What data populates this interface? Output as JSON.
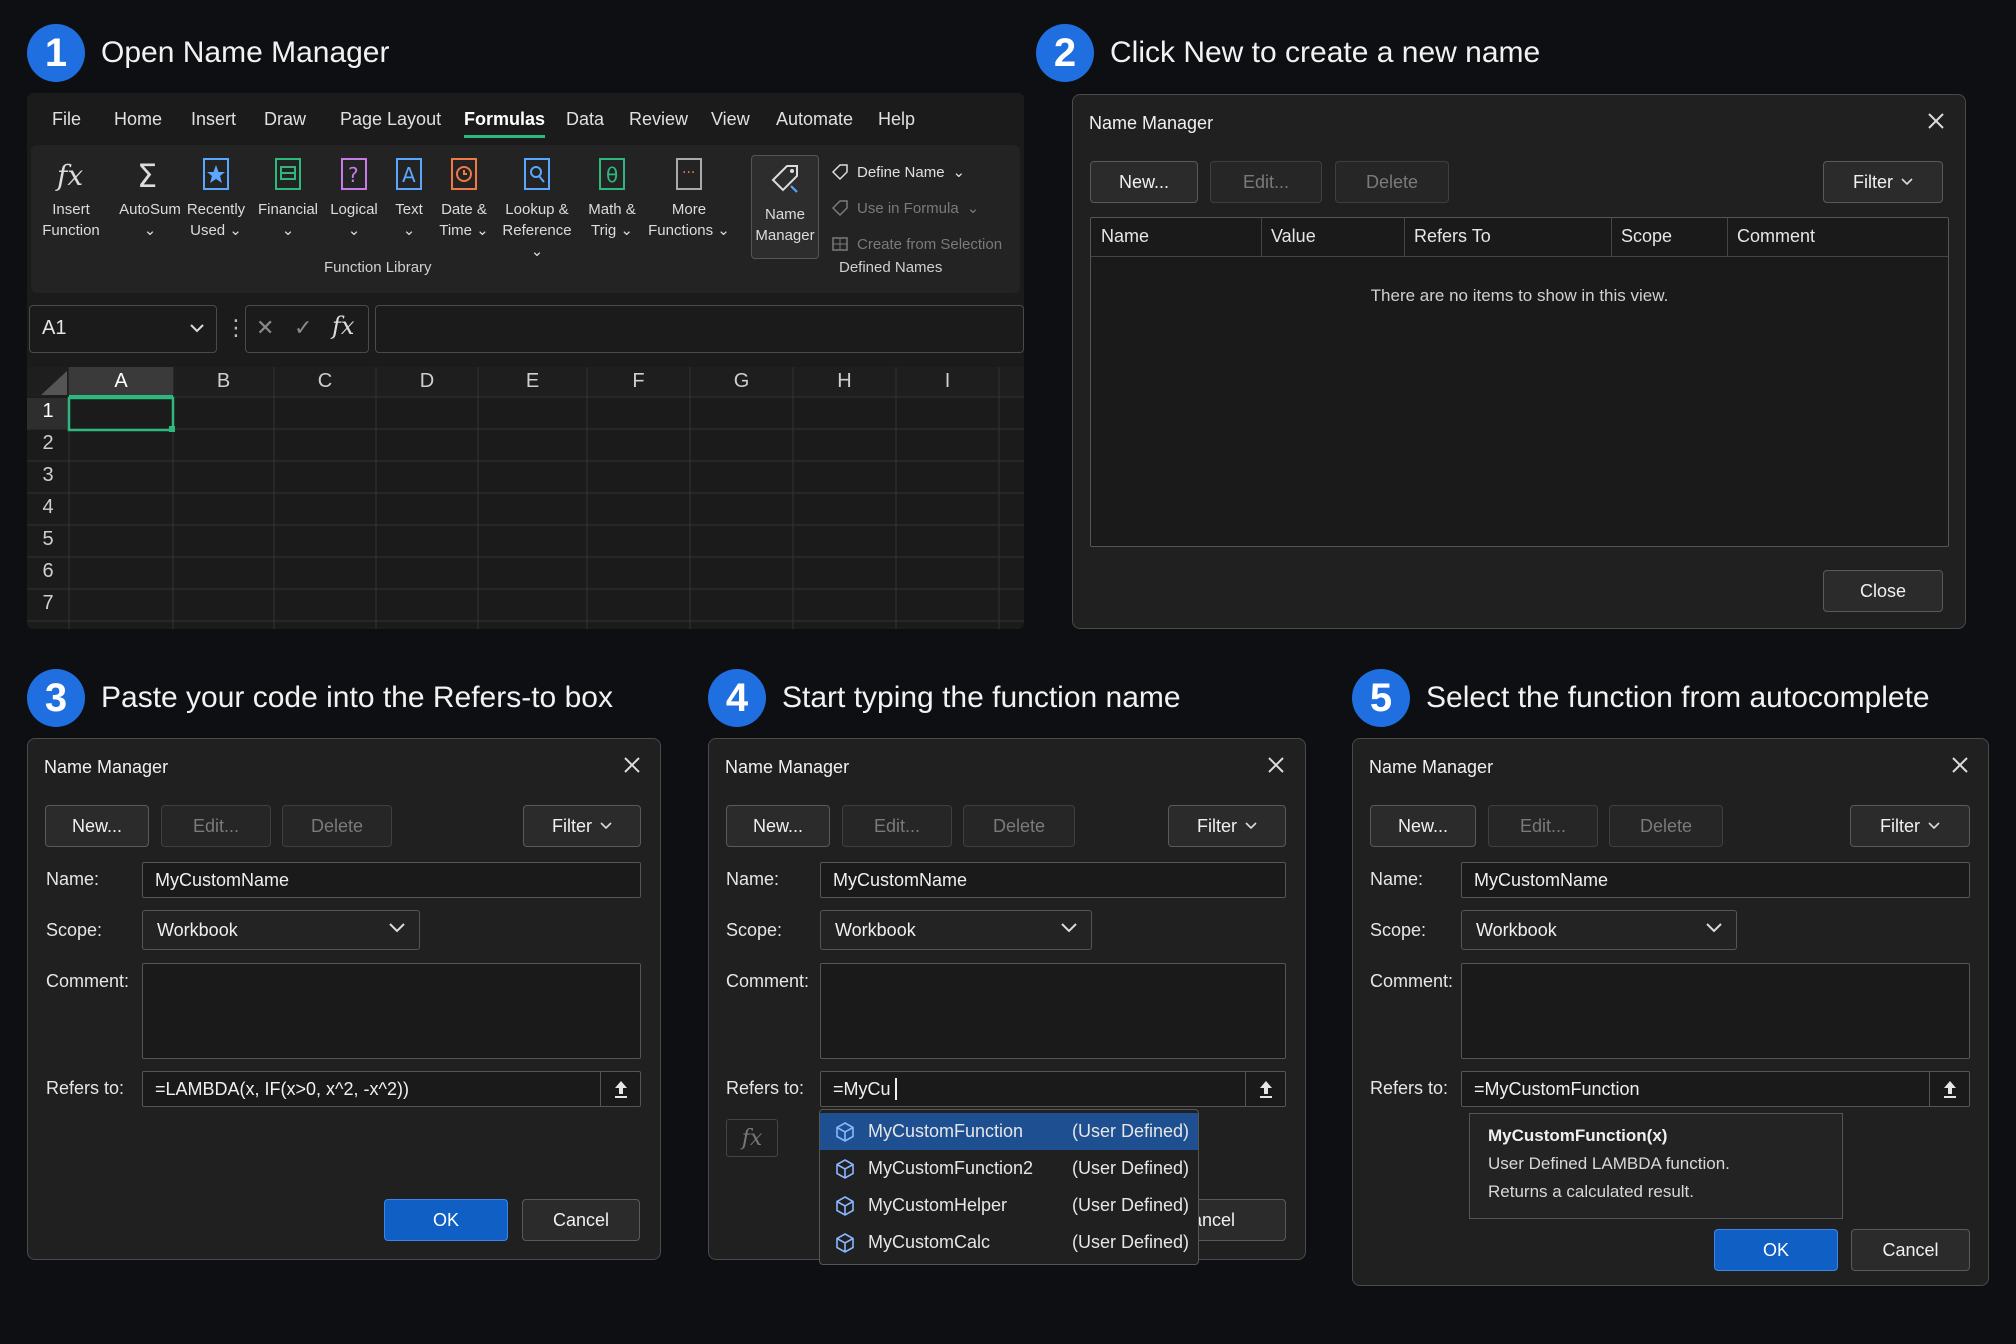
{
  "steps": [
    {
      "num": "1",
      "title": "Open Name Manager"
    },
    {
      "num": "2",
      "title": "Click New to create a new name"
    },
    {
      "num": "3",
      "title": "Paste your code into the Refers-to box"
    },
    {
      "num": "4",
      "title": "Start typing the function name"
    },
    {
      "num": "5",
      "title": "Select the function from autocomplete"
    }
  ],
  "excel": {
    "menu": [
      "File",
      "Home",
      "Insert",
      "Draw",
      "Page Layout",
      "Formulas",
      "Data",
      "Review",
      "View",
      "Automate",
      "Help"
    ],
    "active_menu": "Formulas",
    "ribbon": {
      "insert_function": [
        "Insert",
        "Function"
      ],
      "autosum": [
        "AutoSum",
        "⌄"
      ],
      "recently_used": [
        "Recently",
        "Used ⌄"
      ],
      "financial": [
        "Financial",
        "⌄"
      ],
      "logical": [
        "Logical",
        "⌄"
      ],
      "text": [
        "Text",
        "⌄"
      ],
      "date_time": [
        "Date &",
        "Time ⌄"
      ],
      "lookup": [
        "Lookup &",
        "Reference ⌄"
      ],
      "math": [
        "Math &",
        "Trig ⌄"
      ],
      "more": [
        "More",
        "Functions ⌄"
      ],
      "name_manager": [
        "Name",
        "Manager"
      ],
      "define_name": "Define Name",
      "use_in_formula": "Use in Formula",
      "create_from_selection": "Create from Selection",
      "group_function_library": "Function Library",
      "group_defined_names": "Defined Names"
    },
    "name_box": "A1",
    "columns": [
      "A",
      "B",
      "C",
      "D",
      "E",
      "F",
      "G",
      "H",
      "I"
    ],
    "rows": [
      "1",
      "2",
      "3",
      "4",
      "5",
      "6",
      "7"
    ]
  },
  "dialog_title": "Name Manager",
  "buttons": {
    "new": "New...",
    "edit": "Edit...",
    "delete": "Delete",
    "filter": "Filter",
    "close": "Close",
    "ok": "OK",
    "cancel": "Cancel"
  },
  "table_headers": [
    "Name",
    "Value",
    "Refers To",
    "Scope",
    "Comment"
  ],
  "empty_message": "There are no items to show in this view.",
  "form": {
    "name_label": "Name:",
    "scope_label": "Scope:",
    "comment_label": "Comment:",
    "refers_label": "Refers to:",
    "name_value": "MyCustomName",
    "scope_value": "Workbook"
  },
  "refers_values": {
    "step3": "=LAMBDA(x, IF(x>0, x^2, -x^2))",
    "step4": "=MyCu",
    "step5": "=MyCustomFunction"
  },
  "autocomplete": [
    {
      "name": "MyCustomFunction",
      "type": "(User Defined)"
    },
    {
      "name": "MyCustomFunction2",
      "type": "(User Defined)"
    },
    {
      "name": "MyCustomHelper",
      "type": "(User Defined)"
    },
    {
      "name": "MyCustomCalc",
      "type": "(User Defined)"
    }
  ],
  "tooltip": {
    "signature": "MyCustomFunction(x)",
    "line1": "User Defined LAMBDA function.",
    "line2": "Returns a calculated result."
  },
  "colors": {
    "accent": "#1f6fe0",
    "ok_button": "#0f5fc4",
    "selection": "#1d4f91",
    "excel_active": "#2db87d"
  }
}
